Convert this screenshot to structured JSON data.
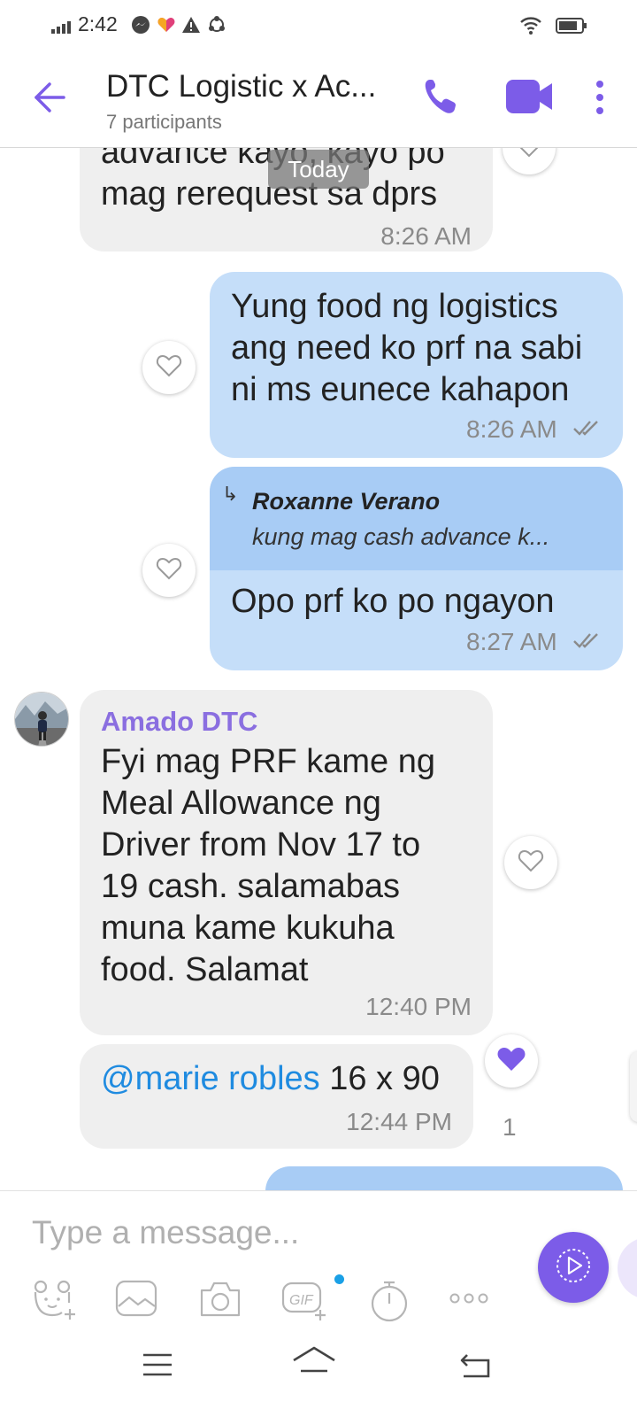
{
  "status_bar": {
    "time": "2:42",
    "icons": [
      "signal-icon",
      "messenger-icon",
      "heart-app-icon",
      "warning-icon",
      "sync-icon",
      "wifi-icon",
      "battery-icon"
    ]
  },
  "header": {
    "title": "DTC Logistic x Ac...",
    "subtitle": "7 participants",
    "icons": [
      "back-arrow-icon",
      "phone-icon",
      "video-call-icon",
      "more-vertical-icon"
    ],
    "accent_color": "#7c5ce8"
  },
  "chat": {
    "date_separator": "Today",
    "messages": [
      {
        "direction": "incoming",
        "text_lines": [
          "advance kayo, kayo po",
          "mag rerequest sa dprs"
        ],
        "time": "8:26 AM"
      },
      {
        "direction": "outgoing",
        "text_lines": [
          "Yung food ng logistics",
          "ang need ko prf na sabi",
          "ni ms eunece kahapon"
        ],
        "time": "8:26 AM",
        "status": "read"
      },
      {
        "direction": "outgoing",
        "reply_to": {
          "author": "Roxanne Verano",
          "snippet": "kung mag cash advance k..."
        },
        "text_lines": [
          "Opo prf ko po ngayon"
        ],
        "time": "8:27 AM",
        "status": "read"
      },
      {
        "direction": "incoming",
        "sender": "Amado DTC",
        "text_lines": [
          "Fyi mag PRF kame ng",
          "Meal Allowance ng",
          "Driver from Nov 17 to",
          "19 cash. salamabas",
          "muna kame kukuha",
          "food. Salamat"
        ],
        "time": "12:40 PM"
      },
      {
        "direction": "incoming",
        "mention": "@marie robles",
        "text": " 16 x 90",
        "time": "12:44 PM",
        "likes": "1",
        "liked": true
      }
    ]
  },
  "composer": {
    "placeholder": "Type a message...",
    "tools": [
      "sticker-icon",
      "gallery-icon",
      "camera-icon",
      "gif-icon",
      "timer-icon",
      "more-horizontal-icon"
    ],
    "send_icon": "send-icon"
  },
  "nav_bar": {
    "icons": [
      "menu-icon",
      "home-icon",
      "back-icon"
    ]
  }
}
